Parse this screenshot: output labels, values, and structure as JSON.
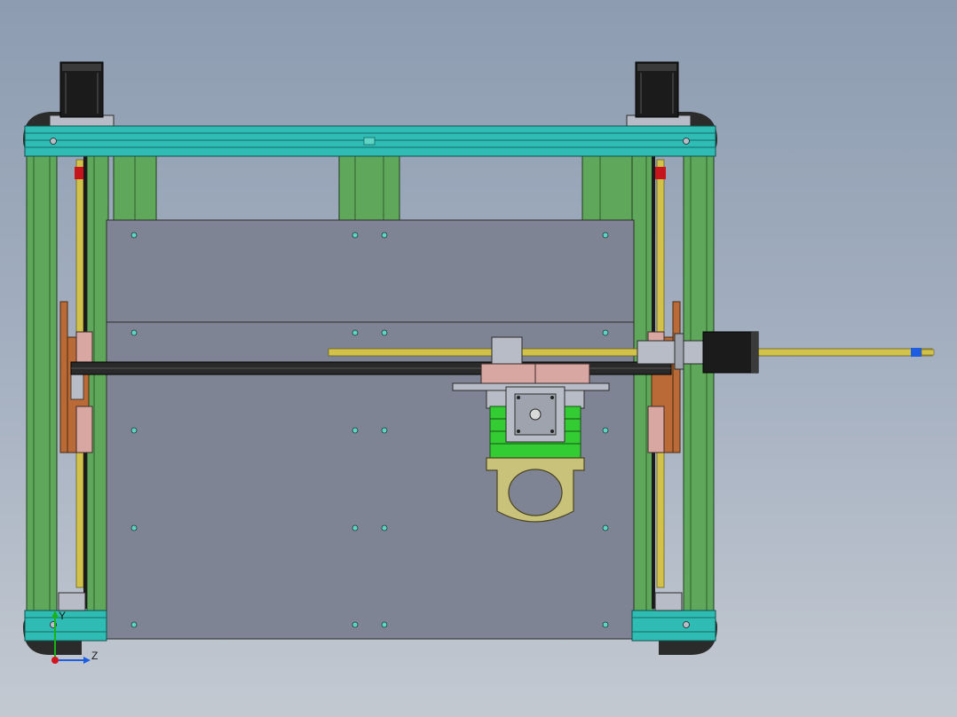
{
  "viewport": {
    "background_top": "#8d9cb1",
    "background_bottom": "#c3c9d1"
  },
  "colors": {
    "frame_green": "#5fa85b",
    "frame_teal": "#2fbcb4",
    "plate_gray": "#7f8494",
    "rail_yellow": "#d2c24a",
    "motor_black": "#1b1b1b",
    "carriage_green": "#33cc33",
    "bracket_khaki": "#c9c27a",
    "slider_pink": "#d9a7a2",
    "bracket_brown": "#b96a36",
    "bolt_teal": "#5fd3c4",
    "axis_y": "#19b219",
    "axis_z": "#1d5de0",
    "axis_origin": "#d4141c"
  },
  "triad": {
    "y_label": "Y",
    "z_label": "Z"
  }
}
